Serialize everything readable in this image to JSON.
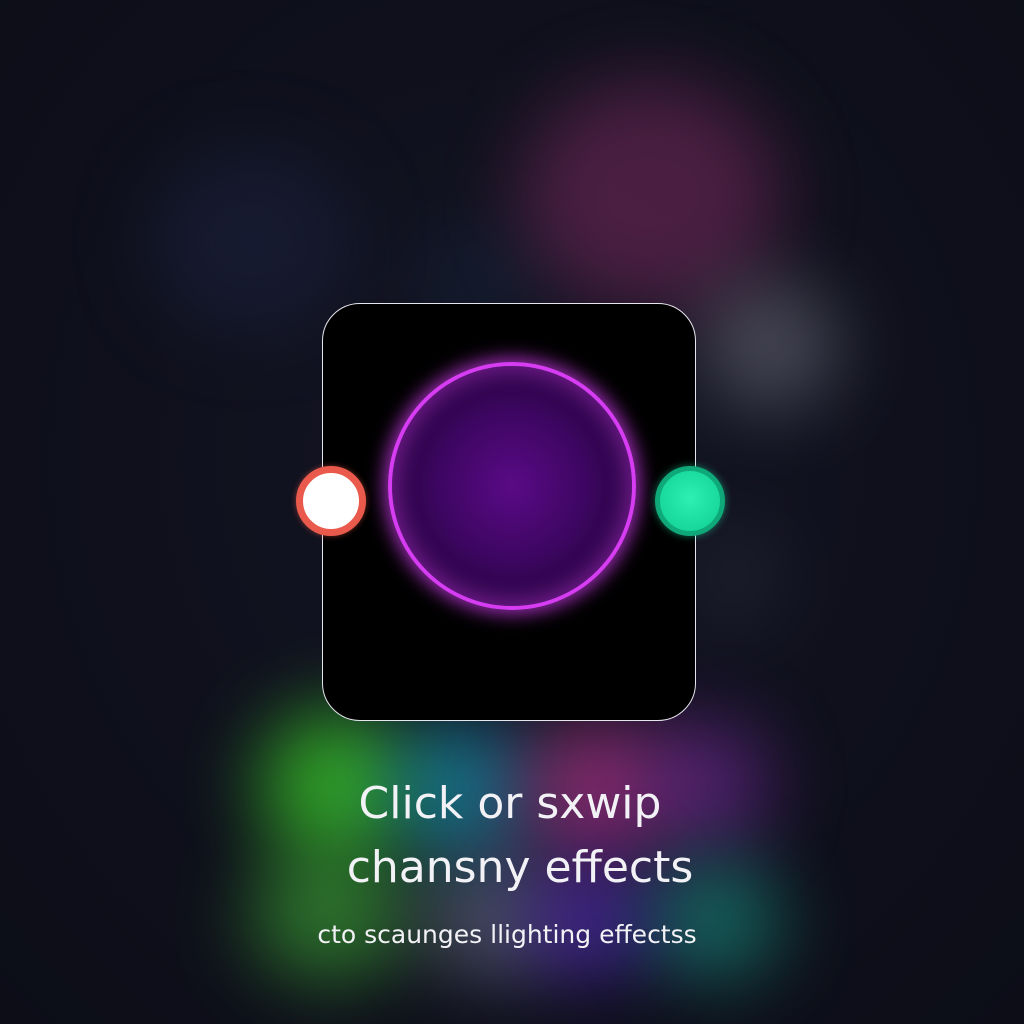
{
  "caption": {
    "line1": "Click  or sxwip",
    "line2": "chansny effects",
    "line3": "cto scaunges llighting effectss"
  },
  "colors": {
    "background": "#0f101c",
    "card": "#000000",
    "card_border": "#e6e6ee",
    "orb_ring": "#d63cf2",
    "left_knob_ring": "#ea5a4c",
    "left_knob_fill": "#ffffff",
    "right_knob_fill": "#18d89c"
  },
  "icons": {
    "left_knob": "off-toggle-icon",
    "right_knob": "on-toggle-icon",
    "orb": "light-orb-icon"
  }
}
